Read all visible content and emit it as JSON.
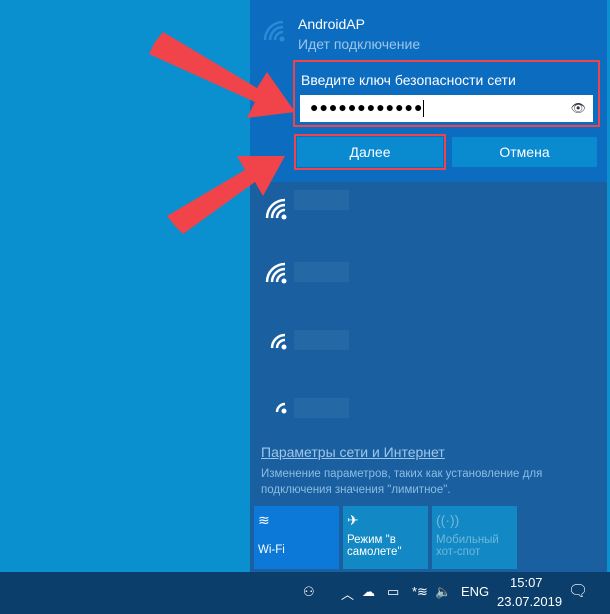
{
  "network": {
    "name": "AndroidAP",
    "status": "Идет подключение",
    "key_label": "Введите ключ безопасности сети",
    "key_value": "●●●●●●●●●●●●",
    "next": "Далее",
    "cancel": "Отмена"
  },
  "settings": {
    "link": "Параметры сети и Интернет",
    "description": "Изменение параметров, таких как установление для подключения значения \"лимитное\"."
  },
  "tiles": [
    {
      "label": "Wi-Fi",
      "icon": "wifi-icon"
    },
    {
      "label": "Режим \"в самолете\"",
      "icon": "airplane-icon"
    },
    {
      "label": "Мобильный хот-спот",
      "icon": "hotspot-icon"
    }
  ],
  "taskbar": {
    "lang": "ENG",
    "time": "15:07",
    "date": "23.07.2019"
  },
  "colors": {
    "annotation": "#f0434a",
    "panel": "#1a5f9f",
    "taskbar": "#0c3e6c"
  }
}
